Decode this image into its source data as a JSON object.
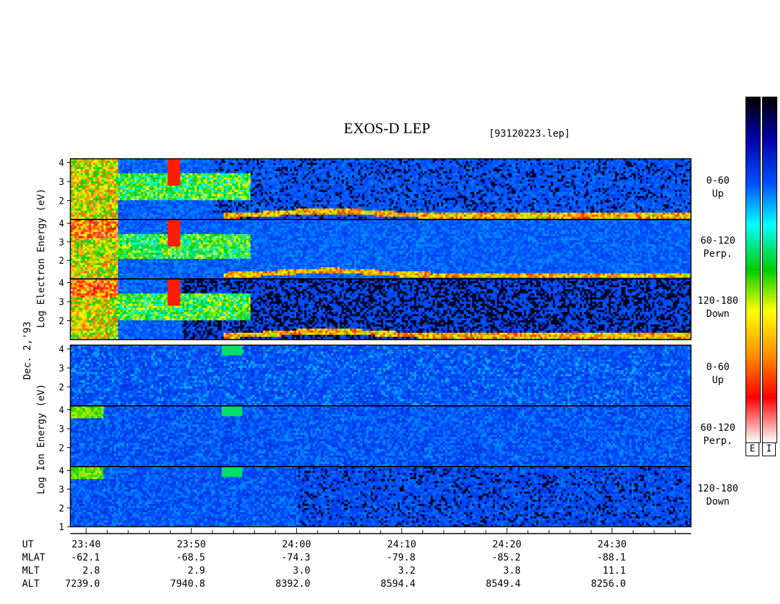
{
  "chart_data": {
    "type": "heatmap",
    "title": "EXOS-D LEP",
    "file": "[93120223.lep]",
    "date_label": "Dec. 2,'93",
    "colors": [
      "#ffffff",
      "#ff0000",
      "#ff8c00",
      "#ffff00",
      "#00cc00",
      "#00ffff",
      "#0050ff",
      "#0000aa",
      "#000000"
    ],
    "groups": [
      {
        "species": "electron",
        "ylabel": "Log  Electron  Energy (eV)",
        "panels": [
          {
            "id": "e-up",
            "label": [
              "0-60",
              "Up"
            ],
            "yticks": [
              2,
              3,
              4
            ]
          },
          {
            "id": "e-perp",
            "label": [
              "60-120",
              "Perp."
            ],
            "yticks": [
              2,
              3,
              4
            ]
          },
          {
            "id": "e-down",
            "label": [
              "120-180",
              "Down"
            ],
            "yticks": [
              2,
              3,
              4
            ]
          }
        ]
      },
      {
        "species": "ion",
        "ylabel": "Log  Ion  Energy (eV)",
        "panels": [
          {
            "id": "i-up",
            "label": [
              "0-60",
              "Up"
            ],
            "yticks": [
              2,
              3,
              4
            ]
          },
          {
            "id": "i-perp",
            "label": [
              "60-120",
              "Perp."
            ],
            "yticks": [
              2,
              3,
              4
            ]
          },
          {
            "id": "i-down",
            "label": [
              "120-180",
              "Down"
            ],
            "yticks": [
              1,
              2,
              3,
              4
            ]
          }
        ]
      }
    ],
    "ylim": [
      1,
      4.2
    ],
    "time_axis": {
      "start_min": 1418.5,
      "end_min": 1477.5,
      "major_ticks": [
        1420,
        1430,
        1440,
        1450,
        1460,
        1470
      ],
      "minor_step": 2
    },
    "ephemeris": {
      "row_names": [
        "UT",
        "MLAT",
        "MLT",
        "ALT"
      ],
      "columns": [
        {
          "UT": "23:40",
          "MLAT": "-62.1",
          "MLT": "2.8",
          "ALT": "7239.0"
        },
        {
          "UT": "23:50",
          "MLAT": "-68.5",
          "MLT": "2.9",
          "ALT": "7940.8"
        },
        {
          "UT": "24:00",
          "MLAT": "-74.3",
          "MLT": "3.0",
          "ALT": "8392.0"
        },
        {
          "UT": "24:10",
          "MLAT": "-79.8",
          "MLT": "3.2",
          "ALT": "8594.4"
        },
        {
          "UT": "24:20",
          "MLAT": "-85.2",
          "MLT": "3.8",
          "ALT": "8549.4"
        },
        {
          "UT": "24:30",
          "MLAT": "-88.1",
          "MLT": "11.1",
          "ALT": "8256.0"
        }
      ]
    },
    "colorbars": [
      {
        "label": "E"
      },
      {
        "label": "I"
      }
    ]
  }
}
